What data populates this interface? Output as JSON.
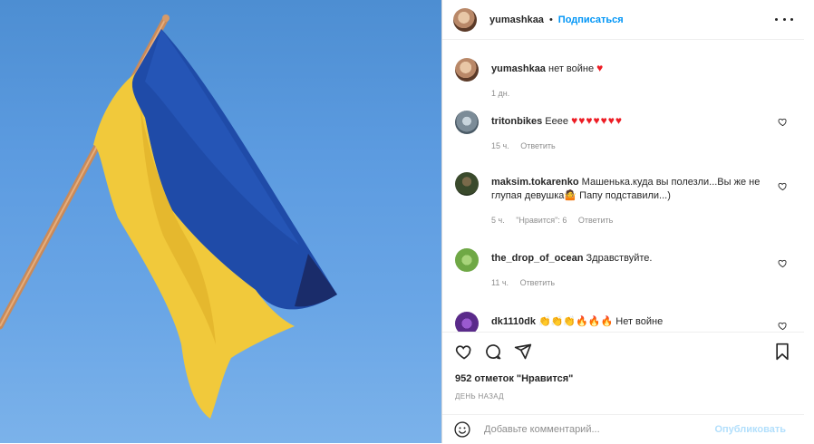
{
  "post": {
    "author": "yumashkaa",
    "separator": "•",
    "follow_label": "Подписаться",
    "caption_text": "нет войне",
    "caption_emoji": "♥",
    "caption_time": "1 дн."
  },
  "comments": [
    {
      "user": "tritonbikes",
      "text": "Eeee",
      "emoji": "♥♥♥♥♥♥♥",
      "time": "15 ч.",
      "likes_label": "",
      "reply_label": "Ответить",
      "avatar_color": "#8aa0b2"
    },
    {
      "user": "maksim.tokarenko",
      "text": "Машенька.куда вы полезли...Вы же не глупая девушка🤷 Папу подставили...)",
      "emoji": "",
      "time": "5 ч.",
      "likes_label": "\"Нравится\": 6",
      "reply_label": "Ответить",
      "avatar_color": "#3a4a2c"
    },
    {
      "user": "the_drop_of_ocean",
      "text": "Здравствуйте.",
      "emoji": "",
      "time": "11 ч.",
      "likes_label": "",
      "reply_label": "Ответить",
      "avatar_color": "#6fa845"
    },
    {
      "user": "dk1110dk",
      "text": "Нет войне",
      "emoji": "👏👏👏🔥🔥🔥",
      "time": "",
      "likes_label": "",
      "reply_label": "",
      "avatar_color": "#5a2a8a"
    }
  ],
  "stats": {
    "likes": "952 отметок \"Нравится\"",
    "posted": "ДЕНЬ НАЗАД"
  },
  "add_comment": {
    "placeholder": "Добавьте комментарий...",
    "publish_label": "Опубликовать"
  },
  "icons": [
    "more-icon",
    "heart-icon",
    "comment-icon",
    "share-icon",
    "bookmark-icon",
    "emoji-icon"
  ],
  "colors": {
    "accent": "#0095f6",
    "flag_blue": "#1f4ba8",
    "flag_yellow": "#f1c93b",
    "sky": "#5c9be0"
  }
}
